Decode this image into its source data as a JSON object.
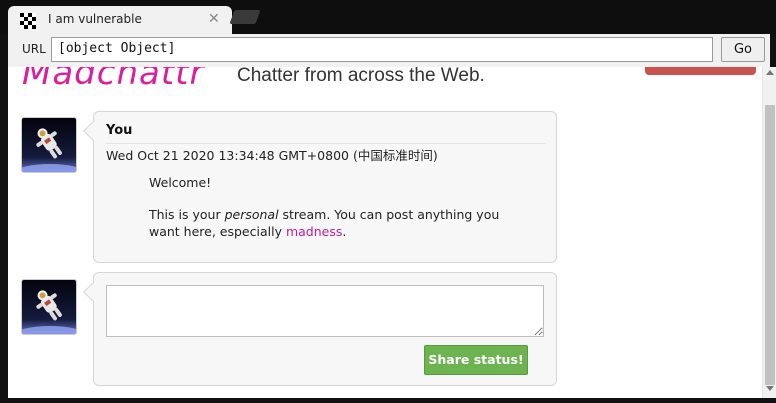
{
  "browser": {
    "tab_title": "I am vulnerable",
    "tab_close": "✕",
    "url_label": "URL",
    "url_value": "[object Object]",
    "go_label": "Go"
  },
  "page": {
    "logo_text": "Madchattr",
    "tagline": "Chatter from across the Web.",
    "post": {
      "author": "You",
      "date": "Wed Oct 21 2020 13:34:48 GMT+0800 (中国标准时间)",
      "welcome": "Welcome!",
      "stream_part1": "This is your ",
      "stream_personal": "personal",
      "stream_part2": " stream. You can post anything you want here, especially ",
      "stream_link": "madness",
      "stream_end": "."
    },
    "composer": {
      "share_label": "Share status!"
    }
  },
  "colors": {
    "brand": "#d91ea0",
    "share_button": "#6db34f",
    "header_button": "#c9534f"
  }
}
